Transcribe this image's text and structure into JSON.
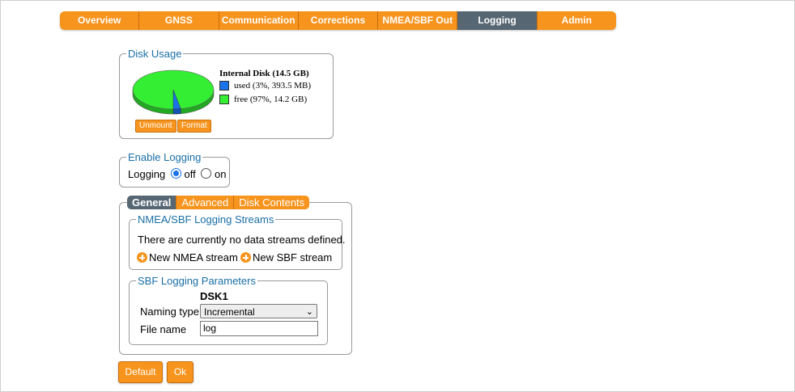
{
  "nav": {
    "items": [
      {
        "label": "Overview"
      },
      {
        "label": "GNSS"
      },
      {
        "label": "Communication"
      },
      {
        "label": "Corrections"
      },
      {
        "label": "NMEA/SBF Out"
      },
      {
        "label": "Logging"
      },
      {
        "label": "Admin"
      }
    ],
    "active": "Logging"
  },
  "disk_usage": {
    "legend": "Disk Usage",
    "title": "Internal Disk (14.5 GB)",
    "used_label": "used (3%, 393.5 MB)",
    "free_label": "free (97%, 14.2 GB)",
    "used_fraction": 0.03,
    "unmount_label": "Unmount",
    "format_label": "Format"
  },
  "enable_logging": {
    "legend": "Enable Logging",
    "label": "Logging",
    "off_label": "off",
    "on_label": "on",
    "selected": "off"
  },
  "tabs": {
    "items": [
      {
        "label": "General"
      },
      {
        "label": "Advanced"
      },
      {
        "label": "Disk Contents"
      }
    ],
    "active": "General"
  },
  "streams": {
    "legend": "NMEA/SBF Logging Streams",
    "empty_text": "There are currently no data streams defined.",
    "new_nmea": "New NMEA stream",
    "new_sbf": "New SBF stream"
  },
  "sbf_params": {
    "legend": "SBF Logging Parameters",
    "column": "DSK1",
    "naming_label": "Naming type",
    "naming_value": "Incremental",
    "file_label": "File name",
    "file_value": "log"
  },
  "buttons": {
    "default": "Default",
    "ok": "Ok"
  },
  "colors": {
    "accent": "#f7941d",
    "active_tab": "#566673",
    "used": "#1a73e8",
    "free": "#33ee33"
  }
}
